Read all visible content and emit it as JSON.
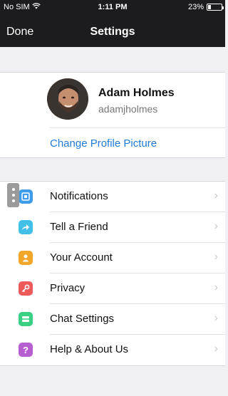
{
  "status": {
    "carrier": "No SIM",
    "time": "1:11 PM",
    "battery": "23%",
    "battery_level": 0.23
  },
  "nav": {
    "done": "Done",
    "title": "Settings"
  },
  "profile": {
    "name": "Adam Holmes",
    "handle": "adamjholmes",
    "change_picture": "Change Profile Picture"
  },
  "menu": [
    {
      "label": "Notifications",
      "icon": "bell-icon",
      "color": "#3d9bea"
    },
    {
      "label": "Tell a Friend",
      "icon": "share-arrow-icon",
      "color": "#42c0e8"
    },
    {
      "label": "Your Account",
      "icon": "person-icon",
      "color": "#f2a62a"
    },
    {
      "label": "Privacy",
      "icon": "key-icon",
      "color": "#ec5a5a"
    },
    {
      "label": "Chat Settings",
      "icon": "chat-icon",
      "color": "#3bcf83"
    },
    {
      "label": "Help & About Us",
      "icon": "question-icon",
      "color": "#b65fd0"
    }
  ],
  "colors": {
    "topbar": "#1c1c1e",
    "link": "#1f7bd6",
    "background": "#efeff4"
  }
}
